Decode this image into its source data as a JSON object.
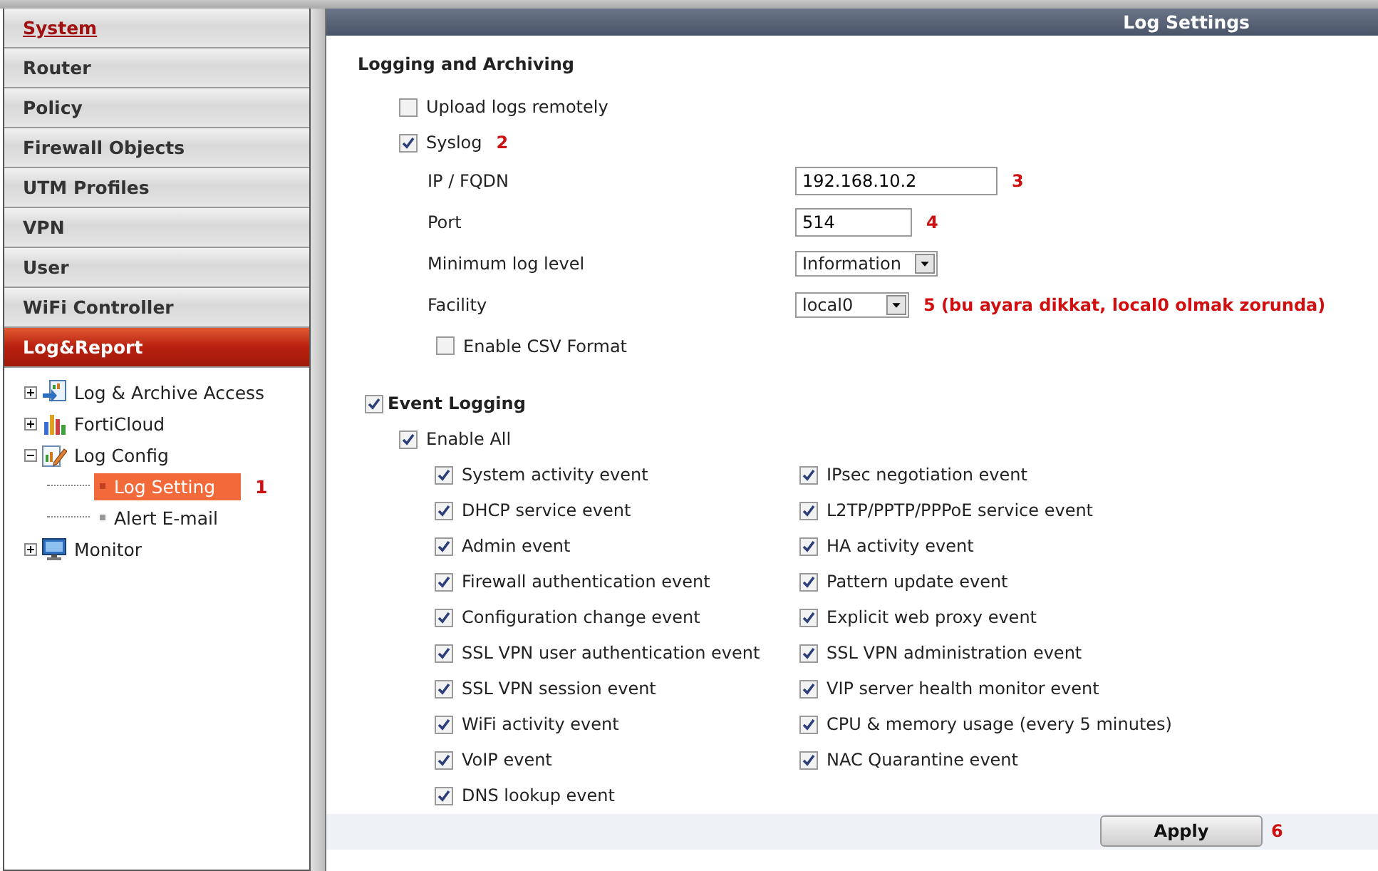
{
  "sidebar": {
    "menu": [
      {
        "label": "System",
        "selected": false,
        "emphasized": true
      },
      {
        "label": "Router",
        "selected": false,
        "emphasized": false
      },
      {
        "label": "Policy",
        "selected": false,
        "emphasized": false
      },
      {
        "label": "Firewall Objects",
        "selected": false,
        "emphasized": false
      },
      {
        "label": "UTM Profiles",
        "selected": false,
        "emphasized": false
      },
      {
        "label": "VPN",
        "selected": false,
        "emphasized": false
      },
      {
        "label": "User",
        "selected": false,
        "emphasized": false
      },
      {
        "label": "WiFi Controller",
        "selected": false,
        "emphasized": false
      },
      {
        "label": "Log&Report",
        "selected": true,
        "emphasized": false
      }
    ],
    "tree": [
      {
        "label": "Log & Archive Access",
        "expanded": false
      },
      {
        "label": "FortiCloud",
        "expanded": false
      },
      {
        "label": "Log Config",
        "expanded": true,
        "children": [
          {
            "label": "Log Setting",
            "selected": true,
            "note": "1"
          },
          {
            "label": "Alert E-mail",
            "selected": false
          }
        ]
      },
      {
        "label": "Monitor",
        "expanded": false
      }
    ]
  },
  "panel": {
    "title": "Log Settings",
    "logging": {
      "heading": "Logging and Archiving",
      "options": [
        {
          "label": "Upload logs remotely",
          "checked": false
        },
        {
          "label": "Syslog",
          "checked": true,
          "note": "2"
        }
      ],
      "fields": [
        {
          "kind": "text",
          "label": "IP / FQDN",
          "value": "192.168.10.2",
          "note": "3"
        },
        {
          "kind": "text",
          "label": "Port",
          "value": "514",
          "note": "4"
        },
        {
          "kind": "select",
          "label": "Minimum log level",
          "value": "Information"
        },
        {
          "kind": "select",
          "label": "Facility",
          "value": "local0",
          "note": "5 (bu ayara dikkat, local0 olmak zorunda)"
        }
      ],
      "csv": {
        "label": "Enable CSV Format",
        "checked": false
      }
    },
    "event_logging": {
      "label": "Event Logging",
      "checked": true,
      "enable_all": {
        "label": "Enable All",
        "checked": true
      },
      "events_left": [
        {
          "label": "System activity event",
          "checked": true
        },
        {
          "label": "DHCP service event",
          "checked": true
        },
        {
          "label": "Admin event",
          "checked": true
        },
        {
          "label": "Firewall authentication event",
          "checked": true
        },
        {
          "label": "Configuration change event",
          "checked": true
        },
        {
          "label": "SSL VPN user authentication event",
          "checked": true
        },
        {
          "label": "SSL VPN session event",
          "checked": true
        },
        {
          "label": "WiFi activity event",
          "checked": true
        },
        {
          "label": "VoIP event",
          "checked": true
        },
        {
          "label": "DNS lookup event",
          "checked": true
        }
      ],
      "events_right": [
        {
          "label": "IPsec negotiation event",
          "checked": true
        },
        {
          "label": "L2TP/PPTP/PPPoE service event",
          "checked": true
        },
        {
          "label": "HA activity event",
          "checked": true
        },
        {
          "label": "Pattern update event",
          "checked": true
        },
        {
          "label": "Explicit web proxy event",
          "checked": true
        },
        {
          "label": "SSL VPN administration event",
          "checked": true
        },
        {
          "label": "VIP server health monitor event",
          "checked": true
        },
        {
          "label": "CPU & memory usage (every 5 minutes)",
          "checked": true
        },
        {
          "label": "NAC Quarantine event",
          "checked": true
        }
      ]
    },
    "apply": {
      "label": "Apply",
      "note": "6"
    }
  }
}
